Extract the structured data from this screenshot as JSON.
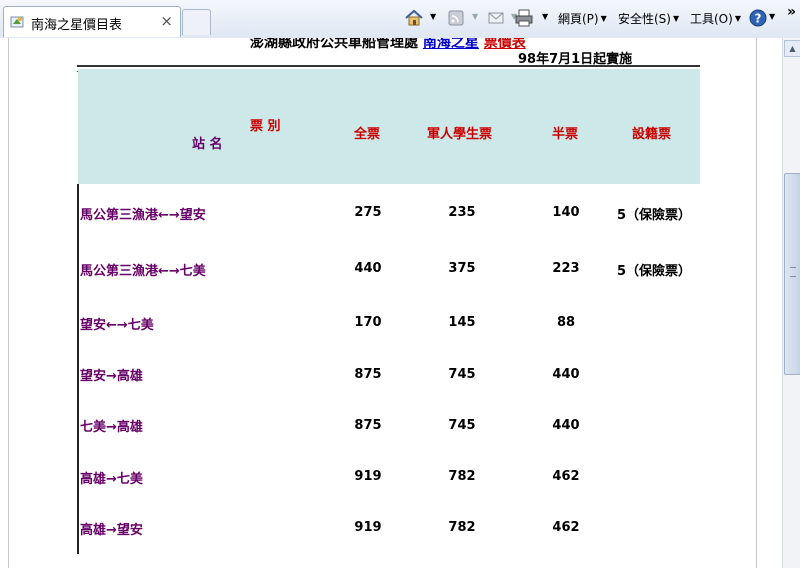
{
  "browser": {
    "tab_title": "南海之星價目表",
    "tab_close": "×",
    "menu_page": "網頁(P)",
    "menu_safety": "安全性(S)",
    "menu_tools": "工具(O)",
    "more": "»"
  },
  "page": {
    "header_prefix": "澎湖縣政府公共車船管理處",
    "header_link": "南海之星",
    "header_suffix": "票價表",
    "effective_date": "98年7月1日起實施",
    "head_ticket_type": "票 別",
    "head_station": "站 名",
    "columns": [
      "全票",
      "軍人學生票",
      "半票",
      "設籍票"
    ],
    "rows": [
      {
        "route": "馬公第三漁港←→望安",
        "full": "275",
        "military_student": "235",
        "half": "140",
        "resident": "5（保險票）"
      },
      {
        "route": "馬公第三漁港←→七美",
        "full": "440",
        "military_student": "375",
        "half": "223",
        "resident": "5（保險票）"
      },
      {
        "route": "望安←→七美",
        "full": "170",
        "military_student": "145",
        "half": "88",
        "resident": ""
      },
      {
        "route": "望安→高雄",
        "full": "875",
        "military_student": "745",
        "half": "440",
        "resident": ""
      },
      {
        "route": "七美→高雄",
        "full": "875",
        "military_student": "745",
        "half": "440",
        "resident": ""
      },
      {
        "route": "高雄→七美",
        "full": "919",
        "military_student": "782",
        "half": "462",
        "resident": ""
      },
      {
        "route": "高雄→望安",
        "full": "919",
        "military_student": "782",
        "half": "462",
        "resident": ""
      }
    ]
  }
}
